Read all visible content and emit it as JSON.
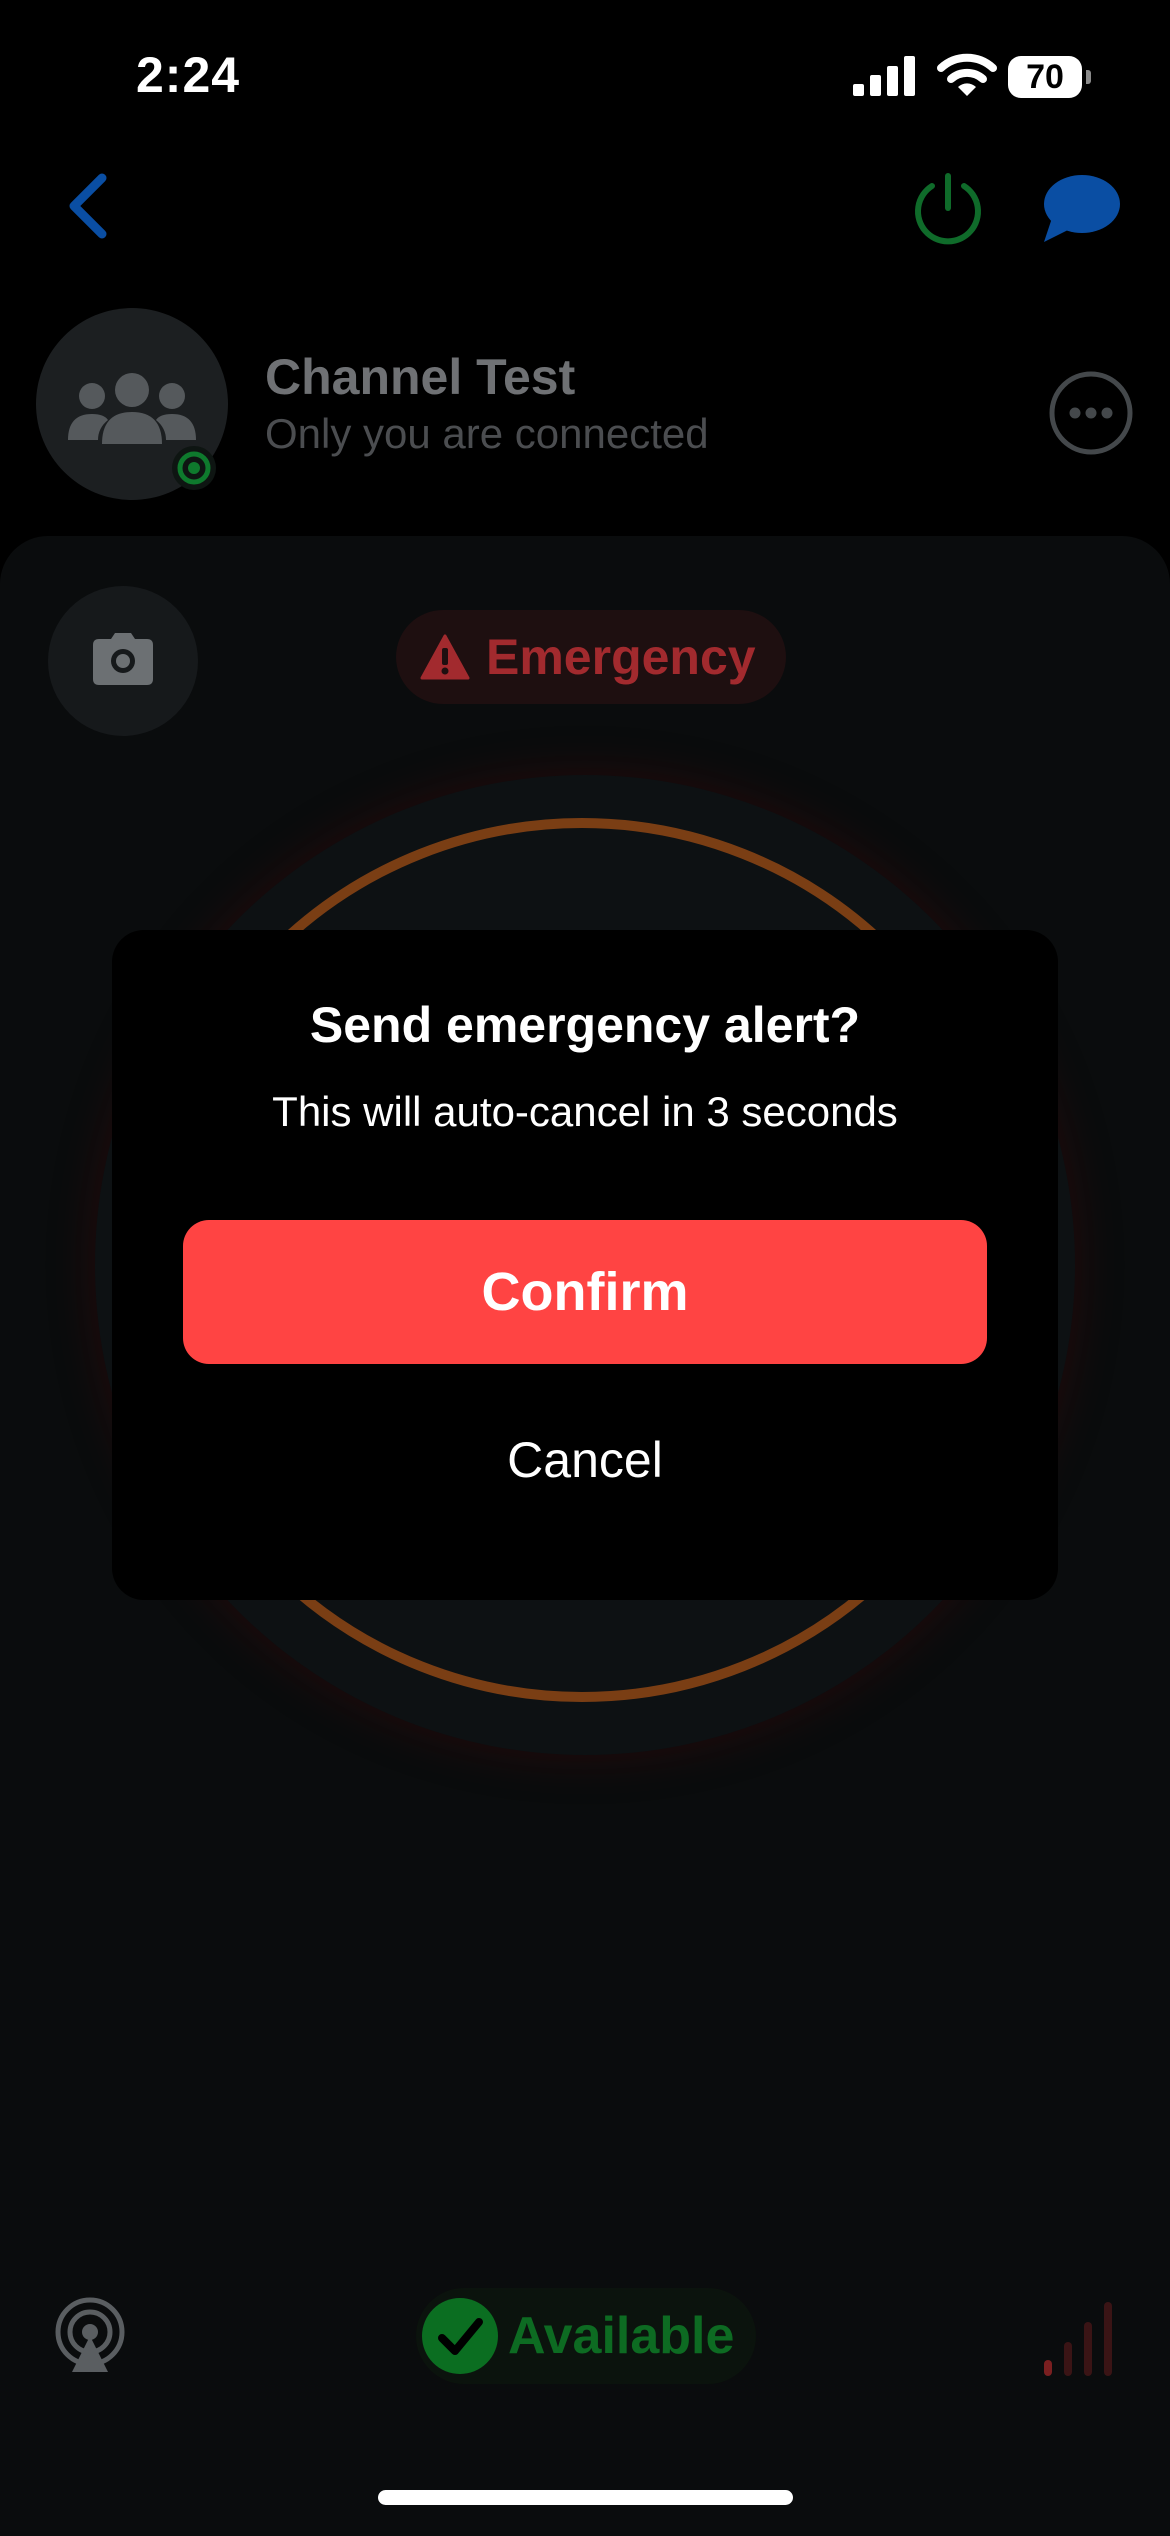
{
  "status_bar": {
    "time": "2:24",
    "battery": "70"
  },
  "channel": {
    "title": "Channel Test",
    "subtitle": "Only you are connected"
  },
  "emergency": {
    "label": "Emergency"
  },
  "dialog": {
    "title": "Send emergency alert?",
    "message": "This will auto-cancel in 3 seconds",
    "confirm_label": "Confirm",
    "cancel_label": "Cancel"
  },
  "presence": {
    "label": "Available"
  },
  "icons": {
    "back": "chevron-left-icon",
    "power": "power-icon",
    "chat": "chat-bubble-icon",
    "group": "group-icon",
    "more": "ellipsis-icon",
    "camera": "camera-icon",
    "warning": "warning-triangle-icon",
    "broadcast": "broadcast-icon",
    "check": "check-icon",
    "bars": "signal-bars-icon"
  },
  "colors": {
    "confirm": "#ff4443",
    "emergency": "#a22a2e",
    "available": "#0d6b22",
    "ring": "#7a3e14",
    "accent_blue": "#0a4ea3",
    "power_green": "#0f6b2a"
  }
}
